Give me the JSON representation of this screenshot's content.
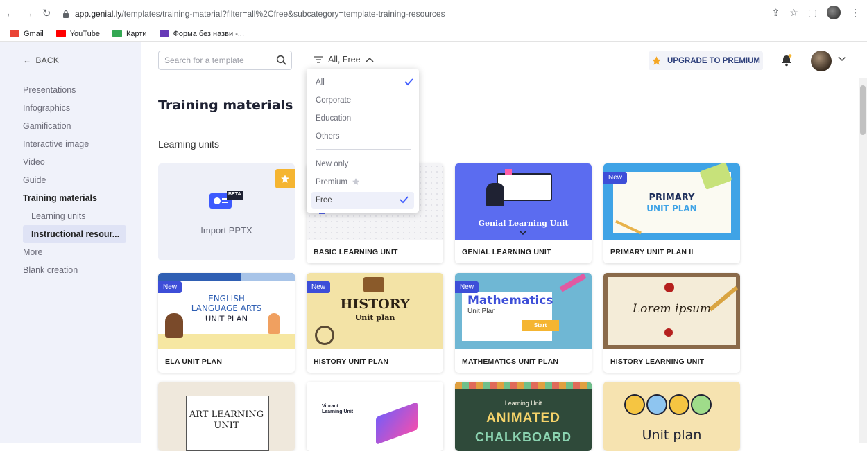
{
  "browser": {
    "url_host": "app.genial.ly",
    "url_rest": "/templates/training-material?filter=all%2Cfree&subcategory=template-training-resources",
    "bookmarks": [
      {
        "label": "Gmail",
        "color": "#ea4335"
      },
      {
        "label": "YouTube",
        "color": "#ff0000"
      },
      {
        "label": "Карти",
        "color": "#34a853"
      },
      {
        "label": "Форма без назви -...",
        "color": "#673ab7"
      }
    ]
  },
  "sidebar": {
    "back_label": "BACK",
    "items": [
      {
        "label": "Presentations"
      },
      {
        "label": "Infographics"
      },
      {
        "label": "Gamification"
      },
      {
        "label": "Interactive image"
      },
      {
        "label": "Video"
      },
      {
        "label": "Guide"
      },
      {
        "label": "Training materials"
      },
      {
        "label": "Learning units"
      },
      {
        "label": "Instructional resour..."
      },
      {
        "label": "More"
      },
      {
        "label": "Blank creation"
      }
    ]
  },
  "topbar": {
    "search_placeholder": "Search for a template",
    "filter_label": "All, Free",
    "upgrade_label": "UPGRADE TO PREMIUM"
  },
  "filter_menu": {
    "group1": [
      {
        "label": "All",
        "checked": true
      },
      {
        "label": "Corporate",
        "checked": false
      },
      {
        "label": "Education",
        "checked": false
      },
      {
        "label": "Others",
        "checked": false
      }
    ],
    "group2": [
      {
        "label": "New only",
        "checked": false
      },
      {
        "label": "Premium",
        "checked": false
      },
      {
        "label": "Free",
        "checked": true
      }
    ]
  },
  "main": {
    "title": "Training materials",
    "section": "Learning units",
    "import_label": "Import PPTX",
    "beta_label": "BETA",
    "new_badge": "New",
    "cards": [
      {
        "label": "BASIC LEARNING UNIT",
        "is_new": false
      },
      {
        "label": "GENIAL LEARNING UNIT",
        "is_new": false,
        "thumb_text": "Genial Learning Unit"
      },
      {
        "label": "PRIMARY UNIT PLAN II",
        "is_new": true,
        "thumb_text": "PRIMARY",
        "thumb_text2": "UNIT PLAN"
      },
      {
        "label": "ELA UNIT PLAN",
        "is_new": true,
        "thumb_text": "ENGLISH",
        "thumb_text2": "LANGUAGE ARTS",
        "thumb_text3": "UNIT PLAN"
      },
      {
        "label": "HISTORY UNIT PLAN",
        "is_new": true,
        "thumb_text": "HISTORY",
        "thumb_text2": "Unit plan"
      },
      {
        "label": "MATHEMATICS UNIT PLAN",
        "is_new": true,
        "thumb_text": "Mathematics",
        "thumb_text2": "Unit Plan",
        "thumb_text3": "Start"
      },
      {
        "label": "HISTORY LEARNING UNIT",
        "is_new": false,
        "thumb_text": "Lorem ipsum"
      },
      {
        "label": "",
        "is_new": false,
        "thumb_text": "ART LEARNING",
        "thumb_text2": "UNIT"
      },
      {
        "label": "",
        "is_new": false,
        "thumb_text": "Vibrant",
        "thumb_text2": "Learning Unit"
      },
      {
        "label": "",
        "is_new": false,
        "thumb_text": "Learning Unit",
        "thumb_text2": "ANIMATED",
        "thumb_text3": "CHALKBOARD"
      },
      {
        "label": "",
        "is_new": false,
        "thumb_text": "Unit plan"
      }
    ]
  }
}
